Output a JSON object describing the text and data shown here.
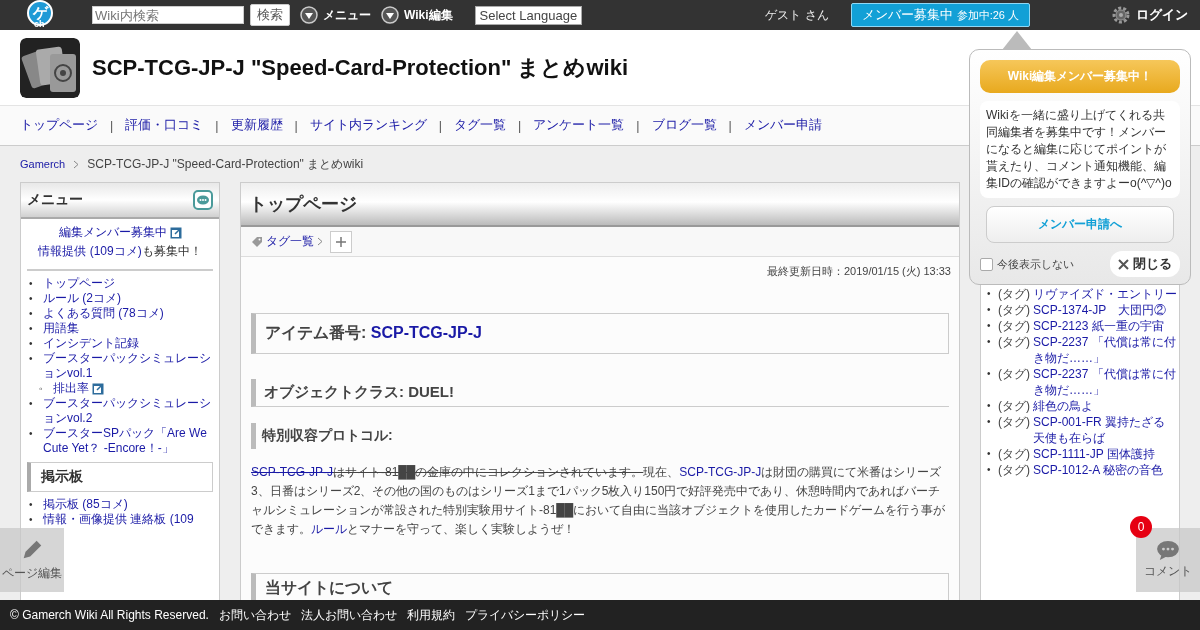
{
  "topbar": {
    "logo": {
      "glyph": "ゲ",
      "sub": "ch"
    },
    "search": {
      "placeholder": "Wiki内検索",
      "button": "検索"
    },
    "menus": [
      {
        "label": "メニュー"
      },
      {
        "label": "Wiki編集"
      }
    ],
    "language_select": "Select Language",
    "user": "ゲスト さん",
    "recruit": {
      "label": "メンバー募集中",
      "count": "参加中:26 人"
    },
    "login": "ログイン"
  },
  "header": {
    "title": "SCP-TCG-JP-J \"Speed-Card-Protection\" まとめwiki"
  },
  "nav": [
    {
      "kind": "link",
      "label": "トップページ"
    },
    {
      "kind": "separator",
      "label": "|"
    },
    {
      "kind": "link",
      "label": "評価・口コミ"
    },
    {
      "kind": "separator",
      "label": "|"
    },
    {
      "kind": "link",
      "label": "更新履歴"
    },
    {
      "kind": "separator",
      "label": "|"
    },
    {
      "kind": "link",
      "label": "サイト内ランキング"
    },
    {
      "kind": "separator",
      "label": "|"
    },
    {
      "kind": "link",
      "label": "タグ一覧"
    },
    {
      "kind": "separator",
      "label": "|"
    },
    {
      "kind": "link",
      "label": "アンケート一覧"
    },
    {
      "kind": "separator",
      "label": "|"
    },
    {
      "kind": "link",
      "label": "ブログ一覧"
    },
    {
      "kind": "separator",
      "label": "|"
    },
    {
      "kind": "link",
      "label": "メンバー申請"
    }
  ],
  "breadcrumb": [
    {
      "label": "Gamerch",
      "link": true
    },
    {
      "label": "SCP-TCG-JP-J \"Speed-Card-Protection\" まとめwiki",
      "link": false
    }
  ],
  "menu_panel": {
    "title": "メニュー",
    "recruit_link": "編集メンバー募集中",
    "info_link": "情報提供 (109コメ)",
    "info_suffix": "も募集中！",
    "items": [
      {
        "bullet": "•",
        "label": "トップページ",
        "kind": "link"
      },
      {
        "bullet": "•",
        "label": "ルール (2コメ)",
        "kind": "link"
      },
      {
        "bullet": "•",
        "label": "よくある質問 (78コメ)",
        "kind": "link"
      },
      {
        "bullet": "•",
        "label": "用語集",
        "kind": "link"
      },
      {
        "bullet": "•",
        "label": "インシデント記録",
        "kind": "link"
      },
      {
        "bullet": "•",
        "label": "ブースターパックシミュレーションvol.1",
        "kind": "link",
        "children": [
          {
            "bullet": "◦",
            "label": "排出率",
            "kind": "external_link"
          }
        ]
      },
      {
        "bullet": "•",
        "label": "ブースターパックシミュレーションvol.2",
        "kind": "link"
      },
      {
        "bullet": "•",
        "label": "ブースターSPパック「Are We Cute Yet？ -Encore！-」",
        "kind": "link"
      }
    ],
    "board_title": "掲示板",
    "board_items": [
      {
        "bullet": "•",
        "label": "掲示板 (85コメ)"
      },
      {
        "bullet": "•",
        "label": "情報・画像提供 連絡板 (109"
      }
    ]
  },
  "main": {
    "title": "トップページ",
    "tags_link": "タグ一覧",
    "updated": "最終更新日時：2019/01/15 (火) 13:33",
    "item_heading": {
      "label": "アイテム番号: ",
      "value": "SCP-TCG-JP-J"
    },
    "class_heading": "オブジェクトクラス: DUEL!",
    "protocol_heading": "特別収容プロトコル:",
    "paragraph": [
      {
        "kind": "link",
        "text": "SCP-TCG-JP-J",
        "struck": true
      },
      {
        "kind": "text",
        "text": "はサイト-81██の金庫の中にコレクションされています。",
        "struck": true
      },
      {
        "kind": "text",
        "text": "現在、",
        "struck": false
      },
      {
        "kind": "link",
        "text": "SCP-TCG-JP-J",
        "struck": false
      },
      {
        "kind": "text",
        "text": "は財団の購買にて米番はシリーズ3、日番はシリーズ2、その他の国のものはシリーズ1まで1パック5枚入り150円で好評発売中であり、休憩時間内であればバーチャルシミュレーションが常設された特別実験用サイト-81██において自由に当該オブジェクトを使用したカードゲームを行う事ができます。",
        "struck": false
      },
      {
        "kind": "link",
        "text": "ルール",
        "struck": false
      },
      {
        "kind": "text",
        "text": "とマナーを守って、楽しく実験しようぜ！",
        "struck": false
      }
    ],
    "about_heading": "当サイトについて"
  },
  "tag_list": [
    {
      "bullet": "•",
      "prefix": "(タグ)",
      "label": "リヴァイズド・エントリー"
    },
    {
      "bullet": "•",
      "prefix": "(タグ)",
      "label": "SCP-1374-JP　大団円②"
    },
    {
      "bullet": "•",
      "prefix": "(タグ)",
      "label": "SCP-2123 紙一重の宇宙"
    },
    {
      "bullet": "•",
      "prefix": "(タグ)",
      "label": "SCP-2237 「代償は常に付き物だ……」"
    },
    {
      "bullet": "•",
      "prefix": "(タグ)",
      "label": "SCP-2237 「代償は常に付き物だ……」"
    },
    {
      "bullet": "•",
      "prefix": "(タグ)",
      "label": "緋色の鳥よ"
    },
    {
      "bullet": "•",
      "prefix": "(タグ)",
      "label": "SCP-001-FR 翼持たざる天使も在らば"
    },
    {
      "bullet": "•",
      "prefix": "(タグ)",
      "label": "SCP-1111-JP 国体護持"
    },
    {
      "bullet": "•",
      "prefix": "(タグ)",
      "label": "SCP-1012-A 秘密の音色"
    }
  ],
  "popup": {
    "title": "Wiki編集メンバー募集中！",
    "body": "Wikiを一緒に盛り上げてくれる共同編集者を募集中です！メンバーになると編集に応じてポイントが貰えたり、コメント通知機能、編集IDの確認ができますよーo(^▽^)o",
    "button": "メンバー申請へ",
    "dont_show": {
      "label": "今後表示しない",
      "checked": false
    },
    "close": "閉じる"
  },
  "float_edit": {
    "label": "ページ編集"
  },
  "float_comment": {
    "label": "コメント",
    "badge": "0"
  },
  "footer": [
    "© Gamerch Wiki All Rights Reserved.",
    "お問い合わせ",
    "法人お問い合わせ",
    "利用規約",
    "プライバシーポリシー"
  ]
}
